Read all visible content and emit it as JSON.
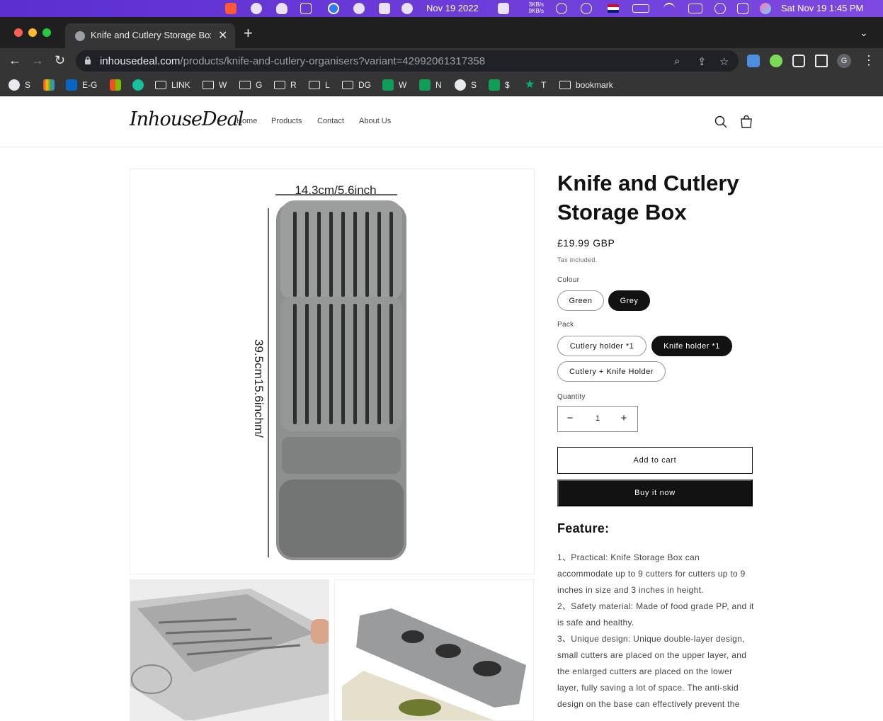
{
  "menubar": {
    "date": "Nov 19 2022",
    "net_up": "3KB/s",
    "net_down": "9KB/s",
    "clock": "Sat Nov 19  1:45 PM"
  },
  "browser": {
    "tab_title": "Knife and Cutlery Storage Box",
    "url_host": "inhousedeal.com",
    "url_path": "/products/knife-and-cutlery-organisers?variant=42992061317358",
    "profile_initial": "G",
    "bookmarks": [
      "S",
      "",
      "E-G",
      "",
      "",
      "LINK",
      "W",
      "G",
      "R",
      "L",
      "DG",
      "W",
      "N",
      "S",
      "$",
      "T",
      "bookmark"
    ]
  },
  "site": {
    "logo": "InhouseDeal",
    "nav": [
      "Home",
      "Products",
      "Contact",
      "About Us"
    ]
  },
  "product": {
    "image_width_label": "14.3cm/5.6inch",
    "image_height_label": "39.5cm15.6inchm/",
    "title": "Knife and Cutlery Storage Box",
    "price": "£19.99 GBP",
    "tax_note": "Tax included.",
    "colour_label": "Colour",
    "colours": [
      "Green",
      "Grey"
    ],
    "selected_colour": "Grey",
    "pack_label": "Pack",
    "packs": [
      "Cutlery holder *1",
      "Knife holder *1",
      "Cutlery + Knife Holder"
    ],
    "selected_pack": "Knife holder *1",
    "quantity_label": "Quantity",
    "quantity": "1",
    "add_to_cart": "Add to cart",
    "buy_now": "Buy it now",
    "feature_heading": "Feature:",
    "features": [
      "1、Practical: Knife Storage Box can accommodate up to 9 cutters for cutters up to 9 inches in size and 3 inches in height.",
      "2、Safety material: Made of food grade PP, and it is safe and healthy.",
      "3、Unique design: Unique double-layer design, small cutters are placed on the upper layer, and the enlarged cutters are placed on the lower layer, fully saving a lot of space. The anti-skid design on the base can effectively prevent the"
    ]
  },
  "colors": {
    "menubar": "#6a3bd8",
    "selected_pill": "#121212",
    "product_grey": "#8e8f8f"
  }
}
